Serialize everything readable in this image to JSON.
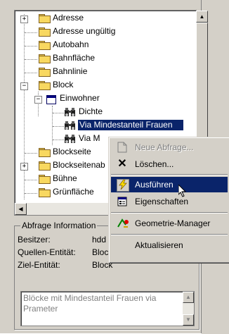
{
  "tree": {
    "items": [
      {
        "label": "Adresse",
        "expander": "+"
      },
      {
        "label": "Adresse ungültig"
      },
      {
        "label": "Autobahn"
      },
      {
        "label": "Bahnfläche"
      },
      {
        "label": "Bahnlinie"
      },
      {
        "label": "Block",
        "expander": "−"
      },
      {
        "label": "Einwohner",
        "expander": "−"
      },
      {
        "label": "Dichte"
      },
      {
        "label": "Via Mindestanteil Frauen"
      },
      {
        "label": "Via M"
      },
      {
        "label": "Blockseite"
      },
      {
        "label": "Blockseitenab",
        "expander": "+"
      },
      {
        "label": "Bühne"
      },
      {
        "label": "Grünfläche"
      }
    ]
  },
  "info": {
    "title": "Abfrage Information",
    "owner_label": "Besitzer:",
    "owner_value": "hdd",
    "source_label": "Quellen-Entität:",
    "source_value": "Block",
    "target_label": "Ziel-Entität:",
    "target_value": "Block",
    "description": "Blöcke mit Mindestanteil Frauen via Prameter"
  },
  "context_menu": {
    "items": [
      {
        "label": "Neue Abfrage...",
        "icon": "new-query-icon",
        "state": "disabled"
      },
      {
        "label": "Löschen...",
        "icon": "delete-x-icon",
        "state": "normal"
      },
      {
        "label": "Ausführen",
        "icon": "lightning-icon",
        "state": "highlighted"
      },
      {
        "label": "Eigenschaften",
        "icon": "properties-icon",
        "state": "normal"
      },
      {
        "label": "Geometrie-Manager",
        "icon": "geometry-manager-icon",
        "state": "normal"
      },
      {
        "label": "Aktualisieren",
        "icon": "",
        "state": "normal"
      }
    ]
  },
  "colors": {
    "selection": "#0a246a",
    "folder": "#f8d860",
    "face": "#d4d0c8"
  }
}
